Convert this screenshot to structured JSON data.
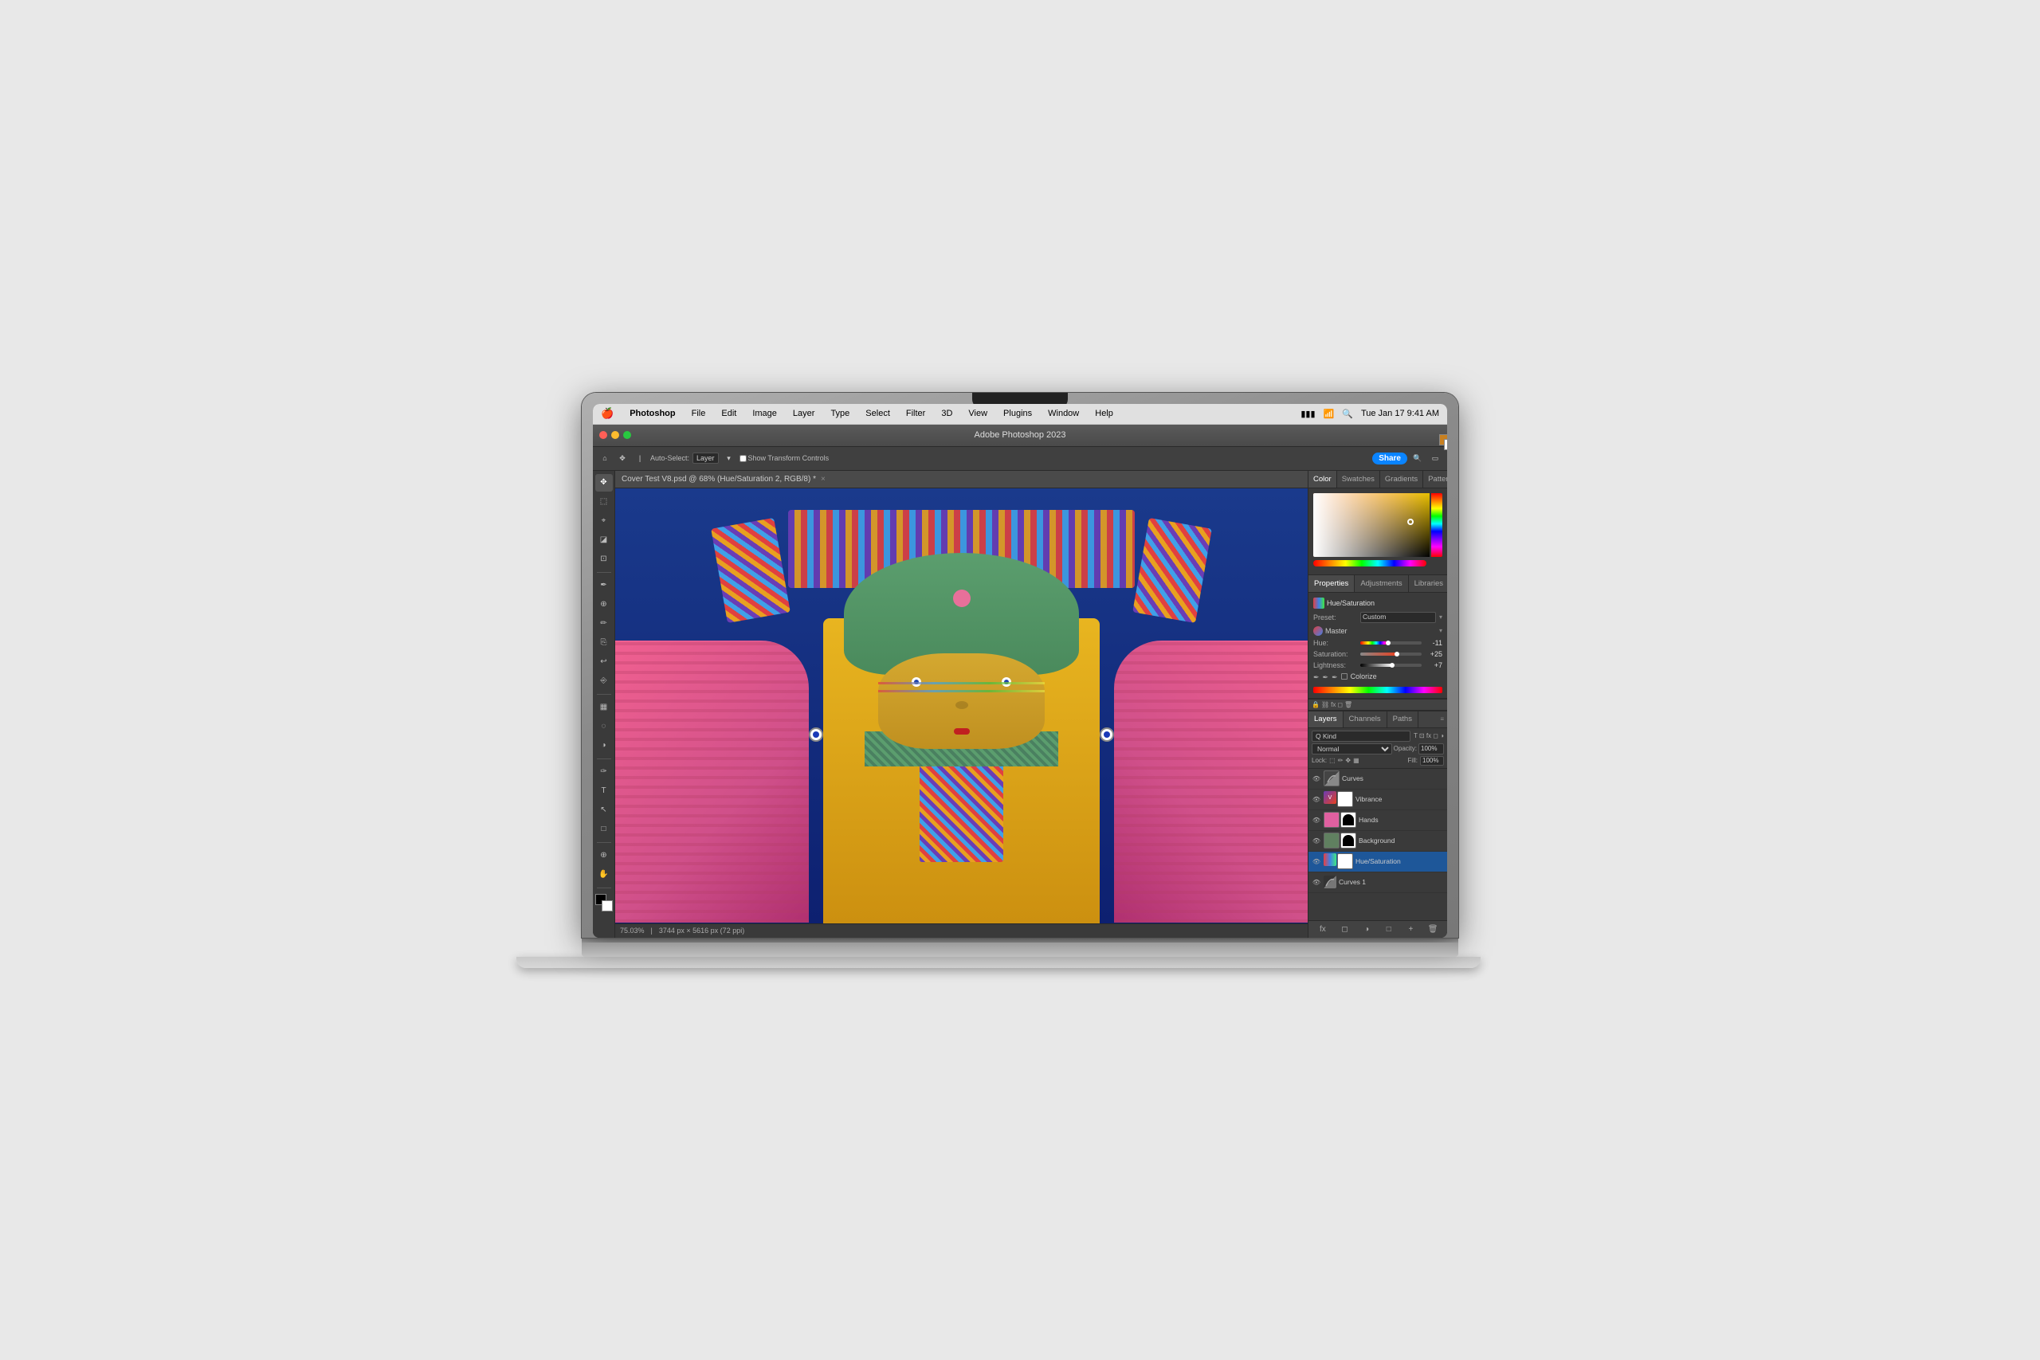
{
  "laptop": {
    "screen_title": "Adobe Photoshop 2023"
  },
  "menubar": {
    "apple": "🍎",
    "app_name": "Photoshop",
    "menus": [
      "File",
      "Edit",
      "Image",
      "Layer",
      "Type",
      "Select",
      "Filter",
      "3D",
      "View",
      "Plugins",
      "Window",
      "Help"
    ],
    "time": "Tue Jan 17  9:41 AM",
    "battery_icon": "🔋",
    "wifi_icon": "📶",
    "search_icon": "🔍"
  },
  "ps": {
    "title": "Adobe Photoshop 2023",
    "doc_tab": "Cover Test V8.psd @ 68% (Hue/Saturation 2, RGB/8) *",
    "status_bar": {
      "zoom": "75.03%",
      "dimensions": "3744 px × 5616 px (72 ppi)"
    },
    "toolbar": {
      "share_label": "Share",
      "auto_select": "Auto-Select:",
      "layer_label": "Layer",
      "transform_label": "Show Transform Controls"
    }
  },
  "color_panel": {
    "tabs": [
      "Color",
      "Swatches",
      "Gradients",
      "Patterns"
    ],
    "active_tab": "Color"
  },
  "properties_panel": {
    "tabs": [
      "Properties",
      "Adjustments",
      "Libraries"
    ],
    "active_tab": "Properties",
    "title": "Hue/Saturation",
    "preset_label": "Preset:",
    "preset_value": "Custom",
    "channel_label": "Master",
    "hue_label": "Hue:",
    "hue_value": "-11",
    "sat_label": "Saturation:",
    "sat_value": "+25",
    "light_label": "Lightness:",
    "light_value": "+7",
    "colorize_label": "Colorize"
  },
  "layers_panel": {
    "tabs": [
      "Layers",
      "Channels",
      "Paths"
    ],
    "active_tab": "Layers",
    "blend_mode": "Normal",
    "opacity_label": "Opacity:",
    "opacity_value": "100%",
    "lock_label": "Lock:",
    "fill_label": "Fill:",
    "fill_value": "100%",
    "search_placeholder": "Q Kind",
    "layers": [
      {
        "name": "Curves",
        "visible": true,
        "type": "adjustment",
        "icon": "curve"
      },
      {
        "name": "Vibrance",
        "visible": true,
        "type": "adjustment",
        "icon": "vibrance"
      },
      {
        "name": "Hands",
        "visible": true,
        "type": "normal",
        "icon": "hands"
      },
      {
        "name": "Background",
        "visible": true,
        "type": "normal",
        "icon": "bg"
      },
      {
        "name": "Hue/Saturation",
        "visible": true,
        "type": "adjustment",
        "icon": "huesat",
        "selected": true
      },
      {
        "name": "Curves 1",
        "visible": true,
        "type": "adjustment",
        "icon": "curves2"
      }
    ]
  }
}
